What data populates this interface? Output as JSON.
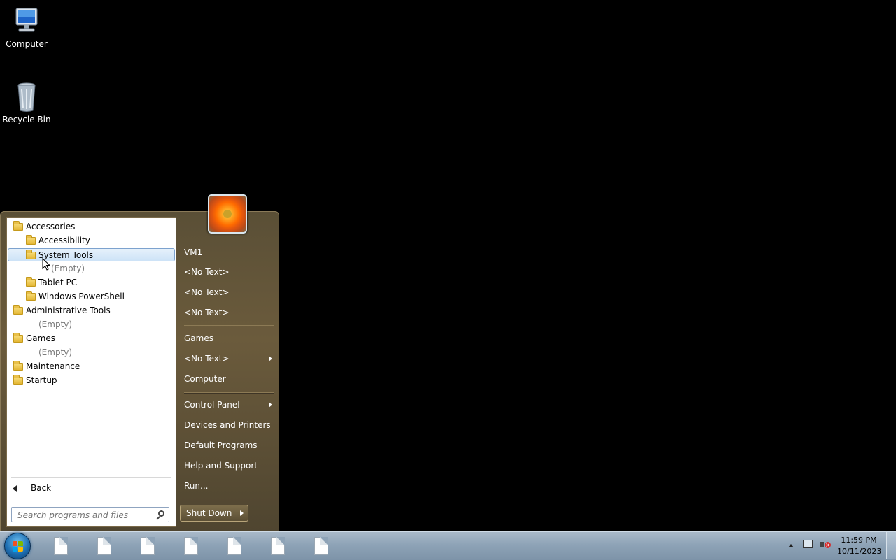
{
  "desktop": {
    "icons": [
      {
        "label": "Computer",
        "icon": "computer-icon"
      },
      {
        "label": "Recycle Bin",
        "icon": "recycle-bin-icon"
      }
    ]
  },
  "start_menu": {
    "programs": [
      {
        "label": "Accessories",
        "level": 0,
        "kind": "folder"
      },
      {
        "label": "Accessibility",
        "level": 1,
        "kind": "folder"
      },
      {
        "label": "System Tools",
        "level": 1,
        "kind": "folder",
        "selected": true
      },
      {
        "label": "(Empty)",
        "level": 2,
        "kind": "empty"
      },
      {
        "label": "Tablet PC",
        "level": 1,
        "kind": "folder"
      },
      {
        "label": "Windows PowerShell",
        "level": 1,
        "kind": "folder"
      },
      {
        "label": "Administrative Tools",
        "level": 0,
        "kind": "folder"
      },
      {
        "label": "(Empty)",
        "level": 1,
        "kind": "empty"
      },
      {
        "label": "Games",
        "level": 0,
        "kind": "folder"
      },
      {
        "label": "(Empty)",
        "level": 1,
        "kind": "empty"
      },
      {
        "label": "Maintenance",
        "level": 0,
        "kind": "folder"
      },
      {
        "label": "Startup",
        "level": 0,
        "kind": "folder"
      }
    ],
    "back_label": "Back",
    "search_placeholder": "Search programs and files",
    "right_pane": {
      "user_name": "VM1",
      "items_group1": [
        "<No Text>",
        "<No Text>",
        "<No Text>"
      ],
      "items_group2": [
        {
          "label": "Games",
          "submenu": false
        },
        {
          "label": "<No Text>",
          "submenu": true
        },
        {
          "label": "Computer",
          "submenu": false
        }
      ],
      "items_group3": [
        {
          "label": "Control Panel",
          "submenu": true
        },
        {
          "label": "Devices and Printers",
          "submenu": false
        },
        {
          "label": "Default Programs",
          "submenu": false
        },
        {
          "label": "Help and Support",
          "submenu": false
        },
        {
          "label": "Run...",
          "submenu": false
        }
      ],
      "shutdown_label": "Shut Down"
    }
  },
  "taskbar": {
    "pinned_count_label": "",
    "clock_time": "11:59 PM",
    "clock_date": "10/11/2023"
  },
  "colors": {
    "menu_bg": "#5a4f36",
    "taskbar": "#8ea3b7",
    "selection": "#cde3f7"
  }
}
